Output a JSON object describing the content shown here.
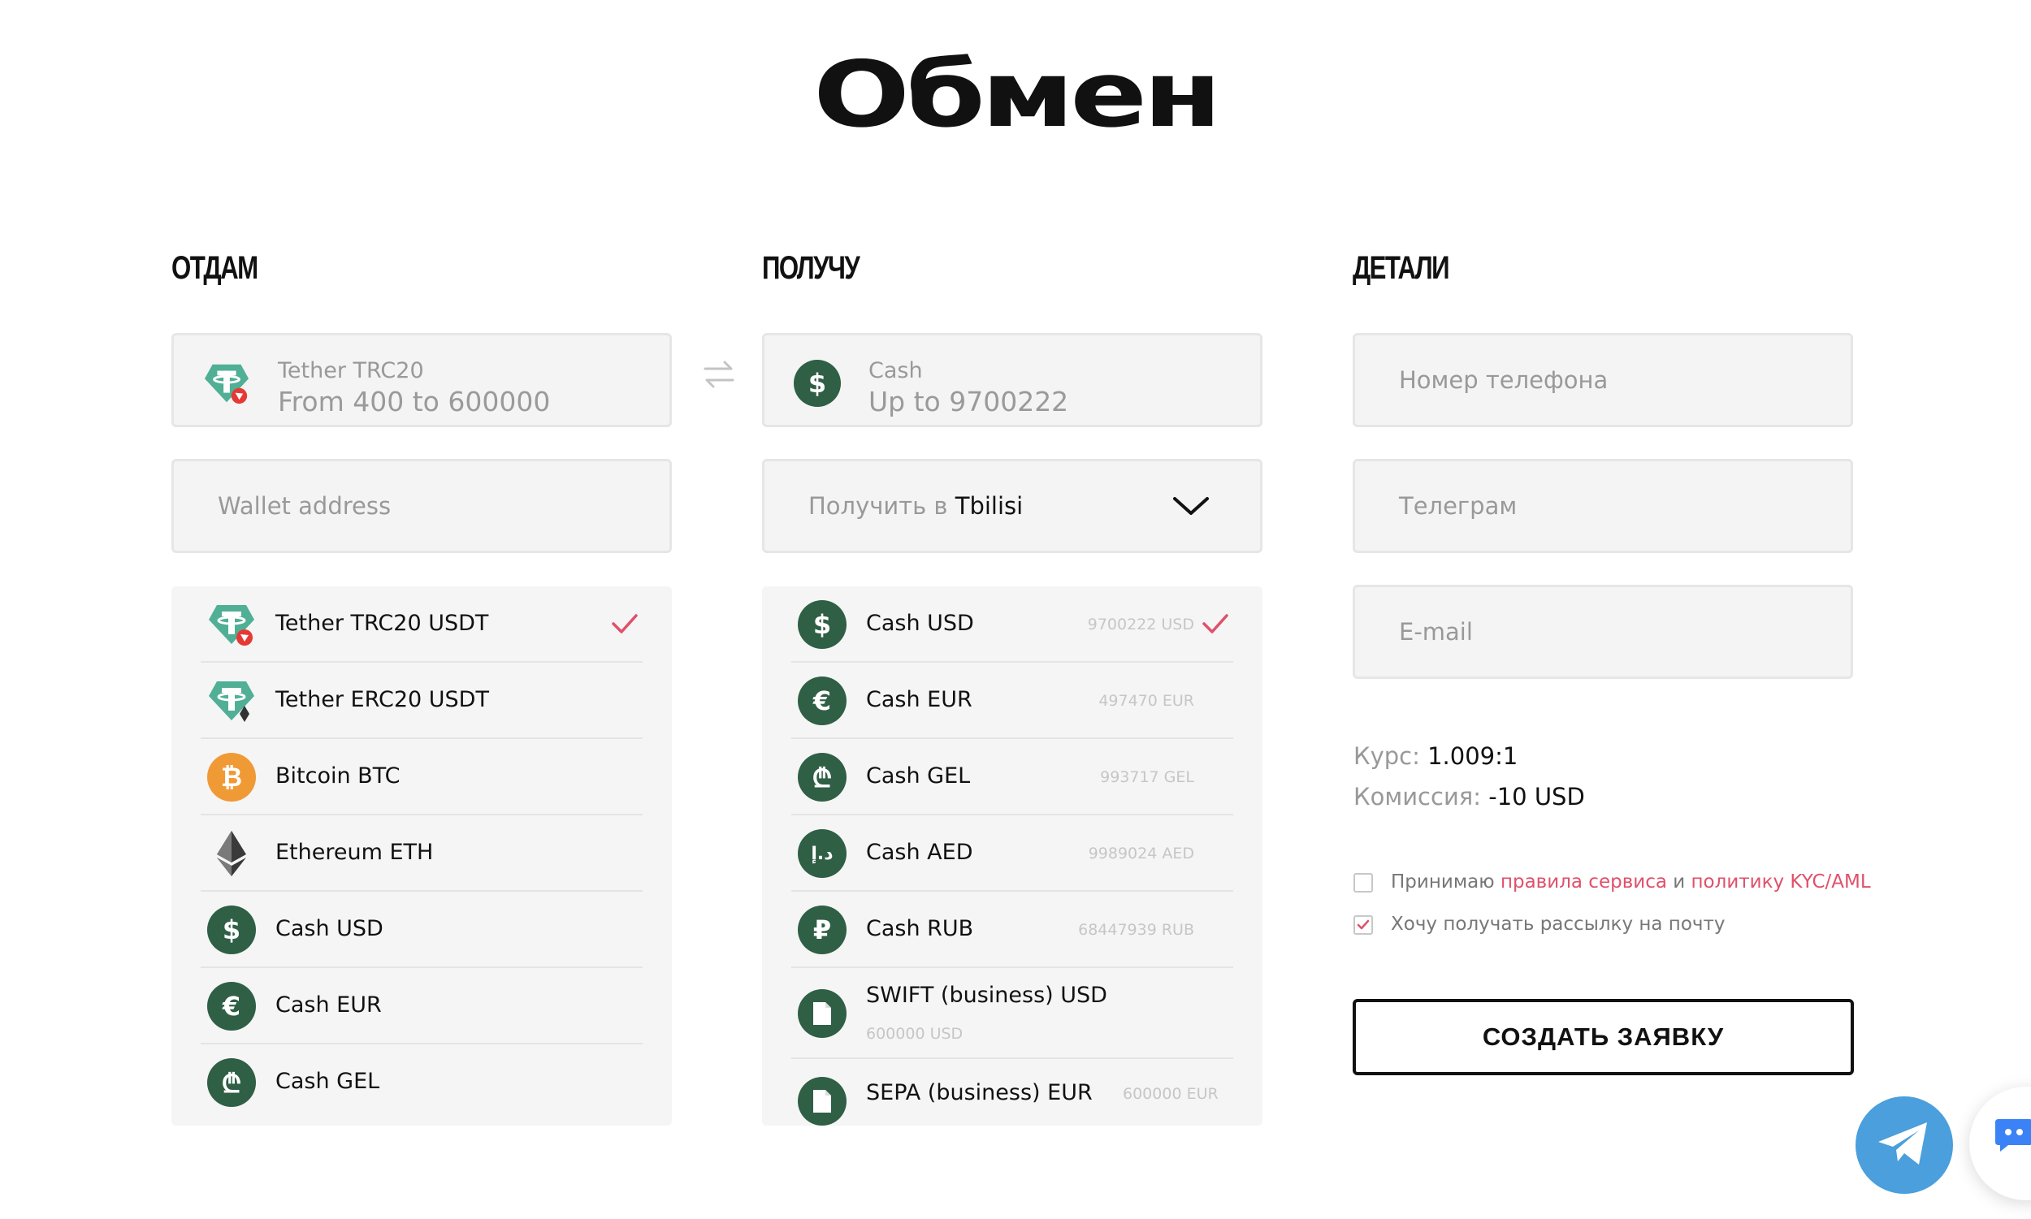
{
  "page": {
    "title": "Обмен"
  },
  "give": {
    "heading": "ОТДАМ",
    "selected": {
      "name": "Tether TRC20",
      "range": "From 400 to 600000"
    },
    "wallet_placeholder": "Wallet address",
    "items": [
      {
        "label": "Tether TRC20 USDT",
        "icon": "tether-trc20-icon",
        "checked": true
      },
      {
        "label": "Tether ERC20 USDT",
        "icon": "tether-erc20-icon"
      },
      {
        "label": "Bitcoin BTC",
        "icon": "bitcoin-icon"
      },
      {
        "label": "Ethereum ETH",
        "icon": "ethereum-icon"
      },
      {
        "label": "Cash USD",
        "icon": "dollar-icon"
      },
      {
        "label": "Cash EUR",
        "icon": "euro-icon"
      },
      {
        "label": "Cash GEL",
        "icon": "lari-icon"
      }
    ]
  },
  "receive": {
    "heading": "ПОЛУЧУ",
    "selected": {
      "name": "Cash",
      "range": "Up to 9700222",
      "icon_glyph": "$"
    },
    "city_prefix": "Получить в",
    "city": "Tbilisi",
    "items": [
      {
        "label": "Cash USD",
        "amount": "9700222 USD",
        "glyph": "$",
        "checked": true
      },
      {
        "label": "Cash EUR",
        "amount": "497470 EUR",
        "glyph": "€"
      },
      {
        "label": "Cash GEL",
        "amount": "993717 GEL",
        "glyph": "₾"
      },
      {
        "label": "Cash AED",
        "amount": "9989024 AED",
        "glyph": "د.إ"
      },
      {
        "label": "Cash RUB",
        "amount": "68447939 RUB",
        "glyph": "₽"
      },
      {
        "label": "SWIFT (business) USD",
        "amount": "600000 USD",
        "glyph": "doc"
      },
      {
        "label": "SEPA (business) EUR",
        "amount": "600000 EUR",
        "glyph": "doc"
      }
    ]
  },
  "details": {
    "heading": "ДЕТАЛИ",
    "phone_placeholder": "Номер телефона",
    "telegram_placeholder": "Телеграм",
    "email_placeholder": "E-mail",
    "rate_label": "Курс:",
    "rate_value": "1.009:1",
    "fee_label": "Комиссия:",
    "fee_value": "-10 USD",
    "terms_prefix": "Принимаю",
    "terms_link1": "правила сервиса",
    "terms_and": "и",
    "terms_link2": "политику KYC/AML",
    "newsletter": "Хочу получать рассылку на почту",
    "terms_checked": false,
    "newsletter_checked": true,
    "submit_label": "СОЗДАТЬ ЗАЯВКУ"
  },
  "colors": {
    "accent": "#e0506a",
    "cash_green": "#2f5f45",
    "tether": "#50af95",
    "bitcoin": "#f09a36",
    "telegram": "#4a9fdc"
  }
}
